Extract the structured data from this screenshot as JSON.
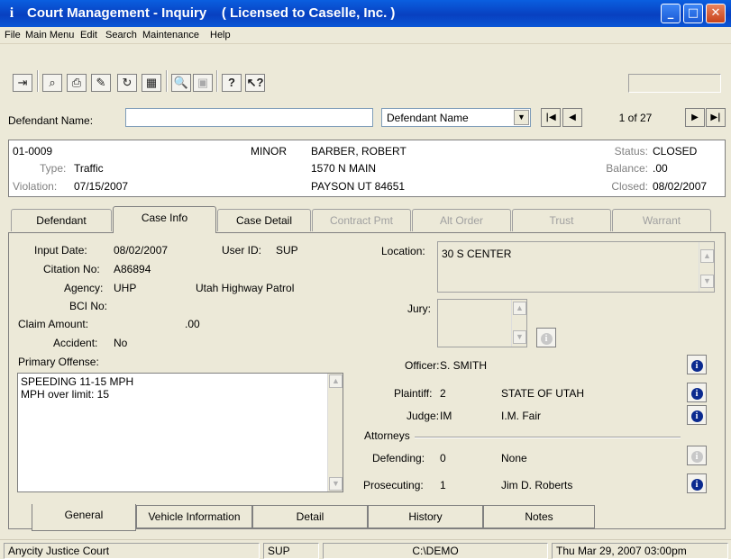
{
  "window": {
    "title": "Court Management - Inquiry",
    "license": "( Licensed to Caselle, Inc. )"
  },
  "menu": [
    "File",
    "Main Menu",
    "Edit",
    "Search",
    "Maintenance",
    "Help"
  ],
  "toolbar_icons": [
    "exit-icon",
    "binoculars-icon",
    "print-icon",
    "edit-icon",
    "refresh-icon",
    "calendar-icon",
    "zoom-icon",
    "image-icon",
    "help-icon",
    "context-help-icon"
  ],
  "search": {
    "label": "Defendant Name:",
    "value": "",
    "mode": "Defendant Name",
    "record": "1 of 27"
  },
  "case_header": {
    "case_no": "01-0009",
    "minor": "MINOR",
    "type_label": "Type:",
    "type": "Traffic",
    "violation_label": "Violation:",
    "violation": "07/15/2007",
    "name": "BARBER, ROBERT",
    "addr1": "1570 N MAIN",
    "addr2": "PAYSON  UT  84651",
    "status_label": "Status:",
    "status": "CLOSED",
    "balance_label": "Balance:",
    "balance": ".00",
    "closed_label": "Closed:",
    "closed": "08/02/2007"
  },
  "tabs": [
    {
      "label": "Defendant",
      "state": "normal"
    },
    {
      "label": "Case Info",
      "state": "active"
    },
    {
      "label": "Case Detail",
      "state": "normal"
    },
    {
      "label": "Contract Pmt",
      "state": "disabled"
    },
    {
      "label": "Alt Order",
      "state": "disabled"
    },
    {
      "label": "Trust",
      "state": "disabled"
    },
    {
      "label": "Warrant",
      "state": "disabled"
    }
  ],
  "case_info": {
    "input_date_label": "Input Date:",
    "input_date": "08/02/2007",
    "user_id_label": "User ID:",
    "user_id": "SUP",
    "citation_label": "Citation No:",
    "citation": "A86894",
    "agency_label": "Agency:",
    "agency_code": "UHP",
    "agency_name": "Utah Highway Patrol",
    "bci_label": "BCI No:",
    "bci": "",
    "claim_label": "Claim Amount:",
    "claim": ".00",
    "accident_label": "Accident:",
    "accident": "No",
    "primary_offense_label": "Primary Offense:",
    "primary_offense_line1": "SPEEDING 11-15 MPH",
    "primary_offense_line2": "MPH over limit:  15",
    "location_label": "Location:",
    "location": "30 S CENTER",
    "jury_label": "Jury:",
    "officer_label": "Officer:",
    "officer": "S. SMITH",
    "plaintiff_label": "Plaintiff:",
    "plaintiff_code": "2",
    "plaintiff_name": "STATE OF UTAH",
    "judge_label": "Judge:",
    "judge_code": "IM",
    "judge_name": "I.M. Fair",
    "attorneys_label": "Attorneys",
    "defending_label": "Defending:",
    "defending_code": "0",
    "defending_name": "None",
    "prosecuting_label": "Prosecuting:",
    "prosecuting_code": "1",
    "prosecuting_name": "Jim D. Roberts"
  },
  "bottom_tabs": [
    {
      "label": "General",
      "state": "active"
    },
    {
      "label": "Vehicle Information",
      "state": "normal"
    },
    {
      "label": "Detail",
      "state": "normal"
    },
    {
      "label": "History",
      "state": "normal"
    },
    {
      "label": "Notes",
      "state": "normal"
    }
  ],
  "statusbar": {
    "court": "Anycity Justice Court",
    "user": "SUP",
    "path": "C:\\DEMO",
    "datetime": "Thu Mar 29, 2007  03:00pm"
  }
}
